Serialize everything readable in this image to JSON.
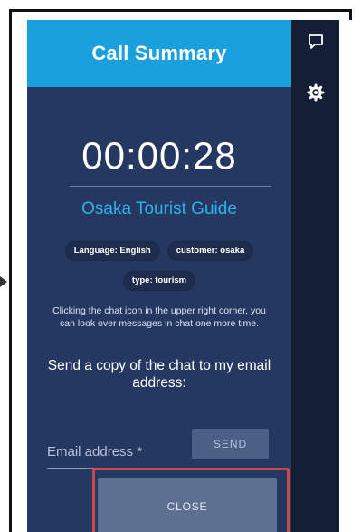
{
  "header": {
    "title": "Call Summary"
  },
  "call": {
    "duration": "00:00:28",
    "guide_name": "Osaka Tourist Guide"
  },
  "tags": [
    "Language: English",
    "customer: osaka",
    "type: tourism"
  ],
  "message": {
    "info": "Clicking the chat icon in the upper right corner, you can look over messages in chat one more time.",
    "copy_label": "Send a copy of the chat to my email address:"
  },
  "form": {
    "email_placeholder": "Email address *",
    "send_label": "SEND",
    "close_label": "CLOSE"
  },
  "icons": {
    "chat": "chat-icon",
    "settings": "gear-icon"
  },
  "colors": {
    "header": "#1aa0dc",
    "panel": "#243862",
    "rail": "#141f36",
    "highlight": "#c84a4a",
    "guide": "#2fb2e8"
  }
}
